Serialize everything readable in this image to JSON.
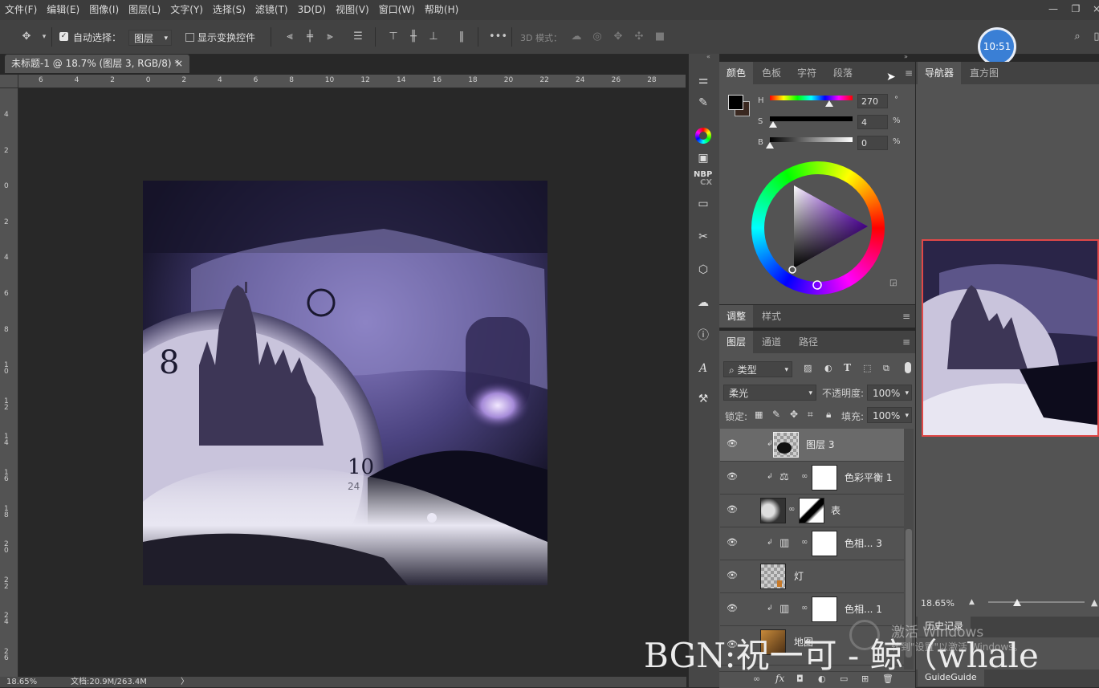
{
  "menu": [
    "文件(F)",
    "编辑(E)",
    "图像(I)",
    "图层(L)",
    "文字(Y)",
    "选择(S)",
    "滤镜(T)",
    "3D(D)",
    "视图(V)",
    "窗口(W)",
    "帮助(H)"
  ],
  "options": {
    "auto_select_label": "自动选择：",
    "auto_select_value": "图层",
    "transform_label": "显示变换控件",
    "mode3d_label": "3D 模式："
  },
  "clock": "10:51",
  "document": {
    "tab_title": "未标题-1 @ 18.7% (图层 3, RGB/8) *",
    "close": "×",
    "ruler_top": [
      "6",
      "4",
      "2",
      "0",
      "2",
      "4",
      "6",
      "8",
      "10",
      "12",
      "14",
      "16",
      "18",
      "20",
      "22",
      "24",
      "26",
      "28"
    ],
    "ruler_left": [
      "4",
      "2",
      "0",
      "2",
      "4",
      "6",
      "8",
      "1 0",
      "1 2",
      "1 4",
      "1 6",
      "1 8",
      "2 0",
      "2 2",
      "2 4",
      "2 6"
    ]
  },
  "status": {
    "zoom": "18.65%",
    "doc": "文档:20.9M/263.4M",
    "arrow": "〉"
  },
  "color_panel": {
    "tabs": [
      "颜色",
      "色板",
      "字符",
      "段落"
    ],
    "h_label": "H",
    "h_value": "270",
    "h_unit": "°",
    "s_label": "S",
    "s_value": "4",
    "s_unit": "%",
    "b_label": "B",
    "b_value": "0",
    "b_unit": "%",
    "h_level": 0.72,
    "s_level": 0.04,
    "b_level": 0.0
  },
  "adjust_panel": {
    "tabs": [
      "调整",
      "样式"
    ]
  },
  "layers_panel": {
    "tabs": [
      "图层",
      "通道",
      "路径"
    ],
    "filter_value": "类型",
    "blend_mode": "柔光",
    "opacity_label": "不透明度:",
    "opacity_value": "100%",
    "lock_label": "锁定:",
    "fill_label": "填充:",
    "fill_value": "100%",
    "layers": [
      {
        "name": "图层 3",
        "selected": true
      },
      {
        "name": "色彩平衡 1",
        "selected": false
      },
      {
        "name": "表",
        "selected": false
      },
      {
        "name": "色相... 3",
        "selected": false
      },
      {
        "name": "灯",
        "selected": false
      },
      {
        "name": "色相... 1",
        "selected": false
      },
      {
        "name": "地图",
        "selected": false
      }
    ],
    "footer_icons": [
      "link-icon",
      "fx-icon",
      "mask-icon",
      "adjustment-icon",
      "folder-icon",
      "new-layer-icon",
      "trash-icon"
    ],
    "fx_label": "fx"
  },
  "navigator": {
    "tabs": [
      "导航器",
      "直方图"
    ],
    "zoom": "18.65%",
    "zoom_level": 0.3,
    "history_tab": "历史记录",
    "guide_tab": "GuideGuide"
  },
  "overlay": {
    "windows_line1": "激活 Windows",
    "windows_line2": "转到\"设置\"以激活 Windows。",
    "bgm_caption": "BGN:祝一可 - 鲸（whale"
  }
}
